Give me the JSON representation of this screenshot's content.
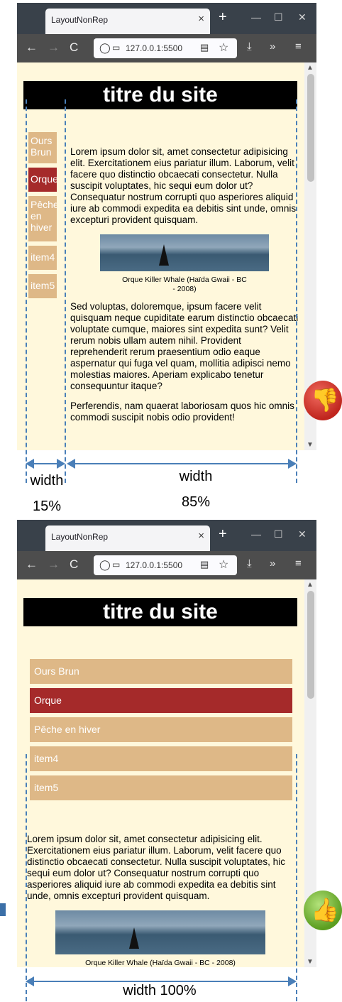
{
  "browser": {
    "tab_title": "LayoutNonRep",
    "tab_close": "×",
    "new_tab": "+",
    "url": "127.0.0.1:5500",
    "controls": {
      "minimize": "—",
      "maximize": "☐",
      "close": "✕"
    },
    "nav": {
      "back": "←",
      "forward": "→",
      "reload": "C"
    },
    "toolbar_icons": {
      "download": "⤓",
      "more": "»",
      "menu": "≡",
      "shield": "◯",
      "page": "▭",
      "reader": "▤",
      "bookmark": "☆"
    }
  },
  "site": {
    "title": "titre du site",
    "menu": [
      {
        "label": "Ours Brun",
        "active": false
      },
      {
        "label": "Orque",
        "active": true
      },
      {
        "label": "Pêche en hiver",
        "active": false
      },
      {
        "label": "item4",
        "active": false
      },
      {
        "label": "item5",
        "active": false
      }
    ],
    "paragraph1": "Lorem ipsum dolor sit, amet consectetur adipisicing elit. Exercitationem eius pariatur illum. Laborum, velit facere quo distinctio obcaecati consectetur. Nulla suscipit voluptates, hic sequi eum dolor ut? Consequatur nostrum corrupti quo asperiores aliquid iure ab commodi expedita ea debitis sint unde, omnis excepturi provident quisquam.",
    "figure_caption": "Orque Killer Whale (Haïda Gwaii - BC - 2008)",
    "paragraph2": "Sed voluptas, doloremque, ipsum facere velit quisquam neque cupiditate earum distinctio obcaecati voluptate cumque, maiores sint expedita sunt? Velit rerum nobis ullam autem nihil. Provident reprehenderit rerum praesentium odio eaque aspernatur qui fuga vel quam, mollitia adipisci nemo molestias maiores. Aperiam explicabo tenetur consequuntur itaque?",
    "paragraph3": "Perferendis, nam quaerat laboriosam quos hic omnis commodi suscipit nobis odio provident!"
  },
  "annotations": {
    "width_label": "width",
    "nav_percent": "15%",
    "content_percent": "85%",
    "full_width": "width 100%"
  },
  "colors": {
    "page_bg": "#fff8dc",
    "menu_item": "#deb887",
    "menu_active": "#a52a2a",
    "header_bg": "#000000",
    "guide": "#4a7fb8",
    "badge_bad": "#c0261e",
    "badge_good": "#5c9e20"
  },
  "icons": {
    "bad_badge": "thumbs-down-icon",
    "good_badge": "thumbs-up-icon"
  }
}
